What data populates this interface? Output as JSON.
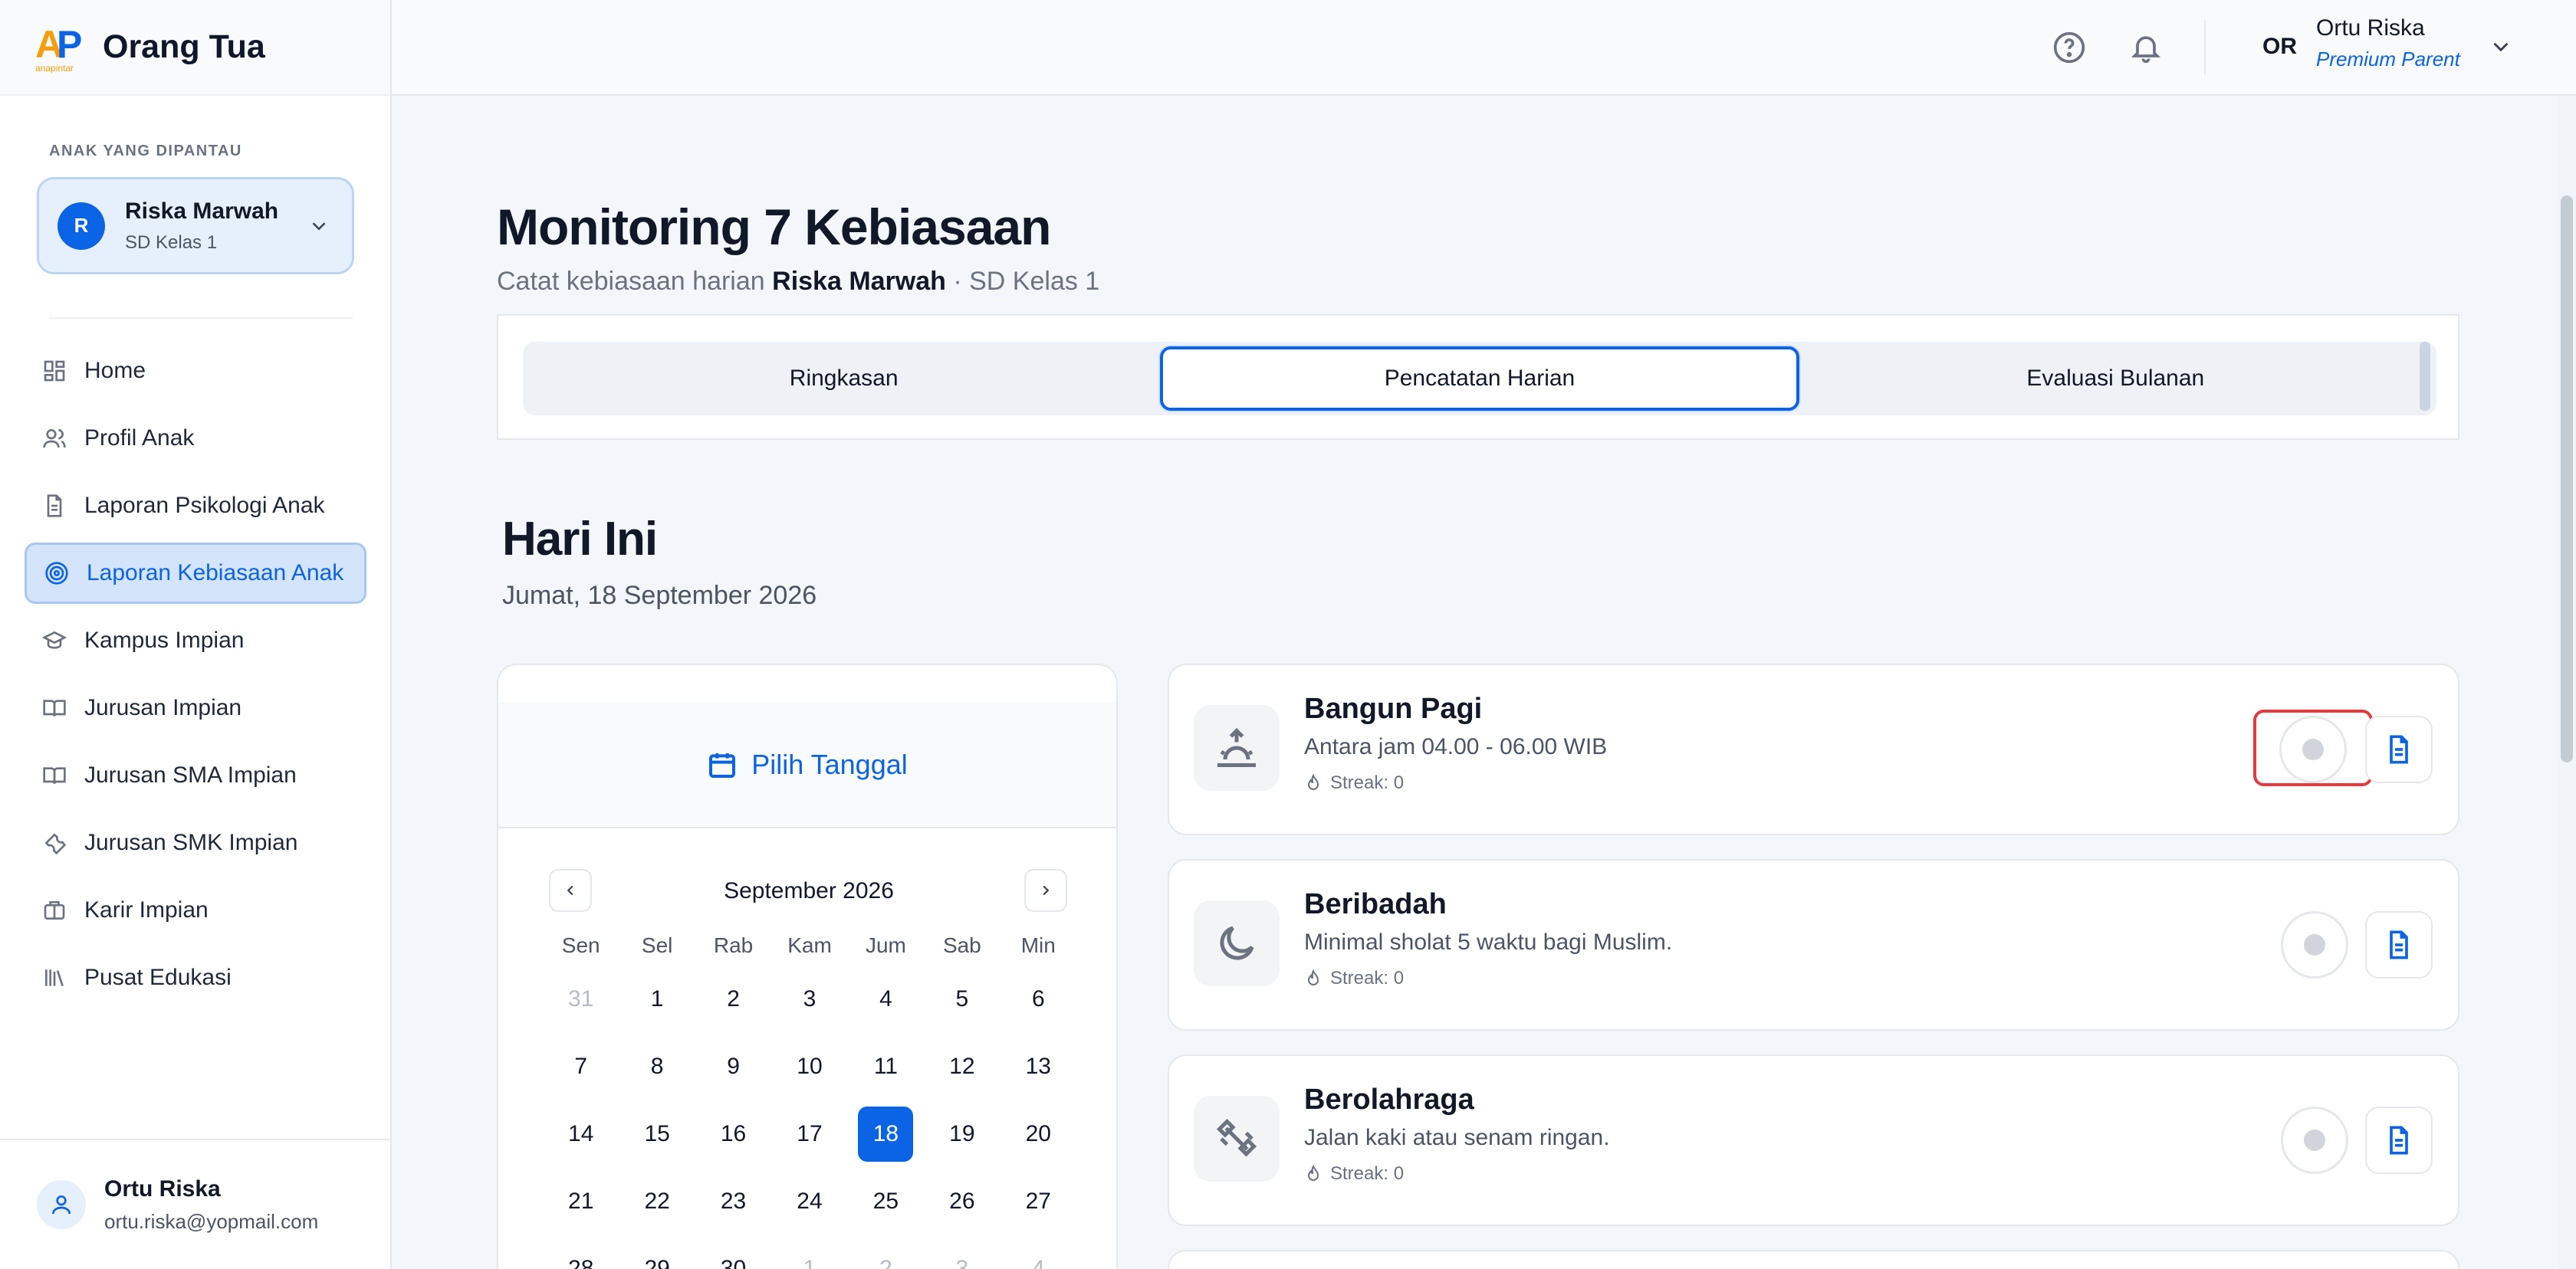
{
  "brand": {
    "title": "Orang Tua",
    "logo_text": "AP",
    "logo_caption": "anapintar"
  },
  "sidebar": {
    "section_label": "ANAK YANG DIPANTAU",
    "child": {
      "initial": "R",
      "name": "Riska Marwah",
      "class": "SD Kelas 1"
    },
    "items": [
      {
        "label": "Home",
        "icon": "grid-icon"
      },
      {
        "label": "Profil Anak",
        "icon": "users-icon"
      },
      {
        "label": "Laporan Psikologi Anak",
        "icon": "document-icon"
      },
      {
        "label": "Laporan Kebiasaan Anak",
        "icon": "target-icon",
        "active": true
      },
      {
        "label": "Kampus Impian",
        "icon": "graduation-cap-icon"
      },
      {
        "label": "Jurusan Impian",
        "icon": "book-icon"
      },
      {
        "label": "Jurusan SMA Impian",
        "icon": "book-icon"
      },
      {
        "label": "Jurusan SMK Impian",
        "icon": "wrench-icon"
      },
      {
        "label": "Karir Impian",
        "icon": "briefcase-icon"
      },
      {
        "label": "Pusat Edukasi",
        "icon": "library-icon"
      }
    ],
    "footer": {
      "name": "Ortu Riska",
      "email": "ortu.riska@yopmail.com"
    }
  },
  "topbar": {
    "initials": "OR",
    "user_name": "Ortu Riska",
    "user_role": "Premium Parent"
  },
  "main": {
    "title": "Monitoring 7 Kebiasaan",
    "subtitle_prefix": "Catat kebiasaan harian",
    "subtitle_name": "Riska Marwah",
    "subtitle_suffix": "· SD Kelas 1",
    "tabs": [
      {
        "label": "Ringkasan"
      },
      {
        "label": "Pencatatan Harian",
        "active": true
      },
      {
        "label": "Evaluasi Bulanan"
      }
    ],
    "today_title": "Hari Ini",
    "today_date": "Jumat, 18 September 2026"
  },
  "calendar": {
    "header": "Pilih Tanggal",
    "month": "September 2026",
    "days_of_week": [
      "Sen",
      "Sel",
      "Rab",
      "Kam",
      "Jum",
      "Sab",
      "Min"
    ],
    "selected": "18",
    "weeks": [
      [
        "31",
        "1",
        "2",
        "3",
        "4",
        "5",
        "6"
      ],
      [
        "7",
        "8",
        "9",
        "10",
        "11",
        "12",
        "13"
      ],
      [
        "14",
        "15",
        "16",
        "17",
        "18",
        "19",
        "20"
      ],
      [
        "21",
        "22",
        "23",
        "24",
        "25",
        "26",
        "27"
      ],
      [
        "28",
        "29",
        "30",
        "1",
        "2",
        "3",
        "4"
      ]
    ]
  },
  "habits": [
    {
      "title": "Bangun Pagi",
      "desc": "Antara jam 04.00 - 06.00 WIB",
      "streak": "Streak: 0",
      "icon": "sunrise-icon",
      "highlighted": true
    },
    {
      "title": "Beribadah",
      "desc": "Minimal sholat 5 waktu bagi Muslim.",
      "streak": "Streak: 0",
      "icon": "moon-icon"
    },
    {
      "title": "Berolahraga",
      "desc": "Jalan kaki atau senam ringan.",
      "streak": "Streak: 0",
      "icon": "dumbbell-icon"
    }
  ],
  "colors": {
    "accent": "#0b63e5",
    "highlight_outline": "#e5393d"
  }
}
